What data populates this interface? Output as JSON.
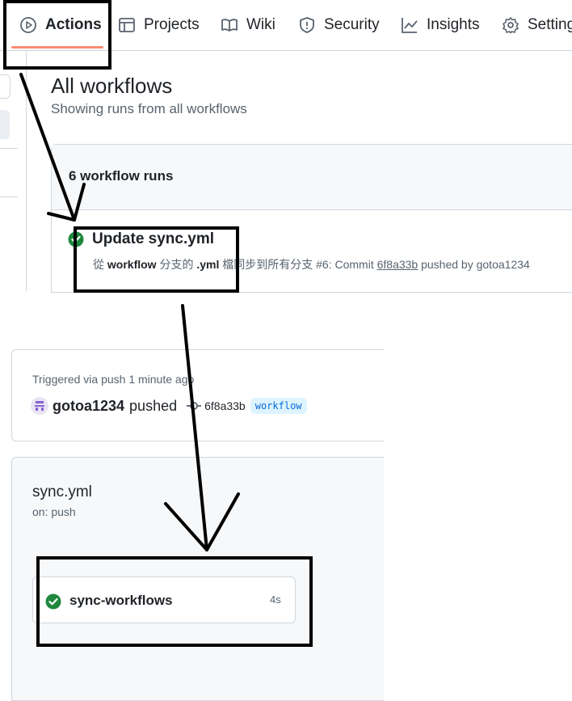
{
  "nav": {
    "tabs": [
      {
        "label": "Actions",
        "icon": "play-icon",
        "active": true
      },
      {
        "label": "Projects",
        "icon": "table-icon"
      },
      {
        "label": "Wiki",
        "icon": "book-icon"
      },
      {
        "label": "Security",
        "icon": "shield-icon"
      },
      {
        "label": "Insights",
        "icon": "graph-icon"
      },
      {
        "label": "Setting",
        "icon": "gear-icon"
      }
    ]
  },
  "main": {
    "title": "All workflows",
    "subtitle": "Showing runs from all workflows",
    "runs_count": "6 workflow runs",
    "run": {
      "title": "Update sync.yml",
      "sub_prefix": "從 ",
      "sub_bold1": "workflow",
      "sub_mid1": " 分支的 ",
      "sub_bold2": ".yml",
      "sub_mid2": " 檔同步到所有分支 #6: Commit ",
      "sub_sha": "6f8a33b",
      "sub_suffix": " pushed by gotoa1234",
      "status": "success"
    }
  },
  "summary": {
    "triggered": "Triggered via push 1 minute ago",
    "user": "gotoa1234",
    "action": "pushed",
    "sha": "6f8a33b",
    "branch": "workflow"
  },
  "workflow": {
    "name": "sync.yml",
    "on": "on: push",
    "job": {
      "name": "sync-workflows",
      "duration": "4s",
      "status": "success"
    }
  },
  "colors": {
    "success": "#1f883d",
    "active_underline": "#fd8c73",
    "link": "#0969da",
    "muted": "#59636e"
  }
}
